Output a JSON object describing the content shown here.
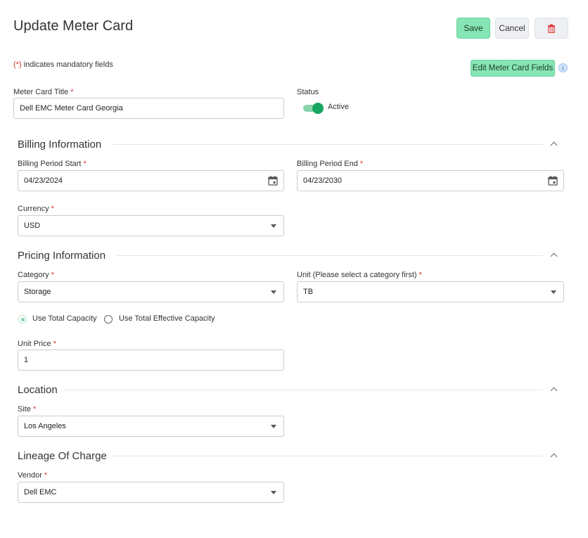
{
  "header": {
    "title": "Update Meter Card",
    "save_label": "Save",
    "cancel_label": "Cancel"
  },
  "mandatory_note": {
    "asterisk": "(*)",
    "text": "indicates mandatory fields"
  },
  "edit_fields_button": "Edit Meter Card Fields",
  "required_marker": "*",
  "meter_card": {
    "title_label": "Meter Card Title",
    "title_value": "Dell EMC Meter Card Georgia",
    "status_label": "Status",
    "status_value": "Active",
    "status_on": true
  },
  "billing": {
    "section_title": "Billing Information",
    "start_label": "Billing Period Start",
    "start_value": "04/23/2024",
    "end_label": "Billing Period End",
    "end_value": "04/23/2030",
    "currency_label": "Currency",
    "currency_value": "USD"
  },
  "pricing": {
    "section_title": "Pricing Information",
    "category_label": "Category",
    "category_value": "Storage",
    "unit_label": "Unit (Please select a category first)",
    "unit_value": "TB",
    "radio_total": "Use Total Capacity",
    "radio_effective": "Use Total Effective Capacity",
    "selected_radio": "total",
    "unit_price_label": "Unit Price",
    "unit_price_value": "1"
  },
  "location": {
    "section_title": "Location",
    "site_label": "Site",
    "site_value": "Los Angeles"
  },
  "lineage": {
    "section_title": "Lineage Of Charge",
    "vendor_label": "Vendor",
    "vendor_value": "Dell EMC"
  },
  "colors": {
    "primary_button": "#86e5b4",
    "toggle_on": "#17a562",
    "required": "#dd3333"
  }
}
